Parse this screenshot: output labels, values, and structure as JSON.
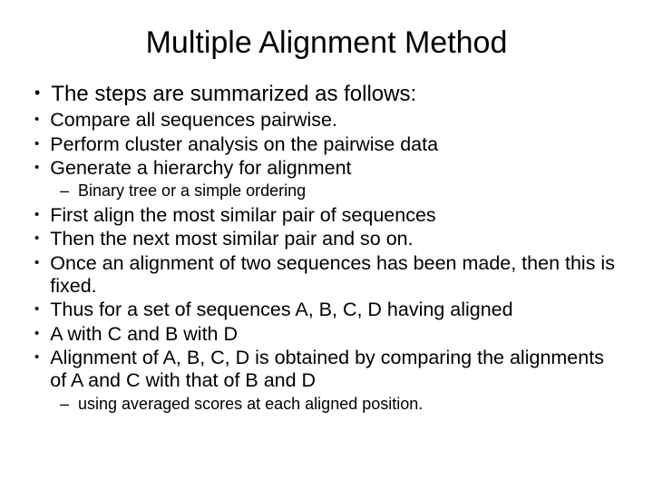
{
  "title": "Multiple Alignment Method",
  "intro": "The steps are summarized as follows:",
  "steps_group1": [
    "Compare all sequences pairwise.",
    "Perform cluster analysis on the pairwise data",
    "Generate a hierarchy for alignment"
  ],
  "sub1": "Binary tree or a simple ordering",
  "steps_group2": [
    "First align the most similar pair of sequences",
    "Then the next most similar pair and so on.",
    "Once an alignment of  two sequences has been made, then this is fixed.",
    "Thus for a set of sequences A, B, C, D having aligned",
    "A with C and B with D",
    "Alignment of A, B, C, D is obtained by comparing the alignments of A and C with that of B and D"
  ],
  "sub2": "using averaged scores at each aligned position."
}
